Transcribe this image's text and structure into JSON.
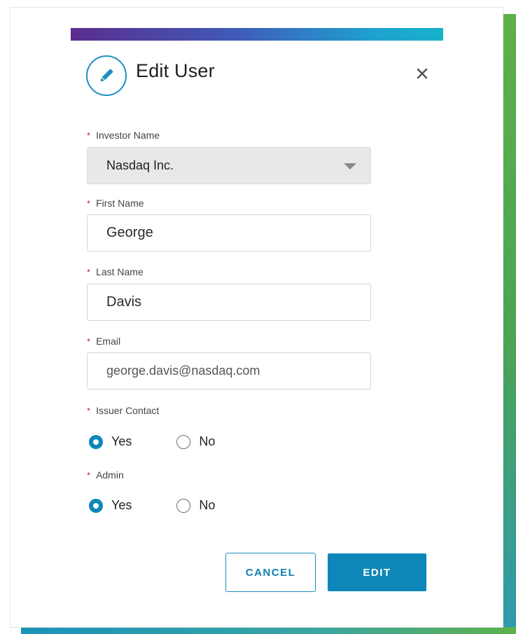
{
  "dialog": {
    "title": "Edit User",
    "header_icon": "pencil-icon",
    "close_icon": "close-icon"
  },
  "fields": {
    "investor_name": {
      "label": "Investor Name",
      "value": "Nasdaq Inc."
    },
    "first_name": {
      "label": "First Name",
      "value": "George"
    },
    "last_name": {
      "label": "Last Name",
      "value": "Davis"
    },
    "email": {
      "label": "Email",
      "value": "george.davis@nasdaq.com"
    },
    "issuer_contact": {
      "label": "Issuer Contact",
      "options": [
        "Yes",
        "No"
      ],
      "selected": "Yes"
    },
    "admin": {
      "label": "Admin",
      "options": [
        "Yes",
        "No"
      ],
      "selected": "Yes"
    }
  },
  "required_marker": "*",
  "buttons": {
    "cancel": "CANCEL",
    "edit": "EDIT"
  },
  "colors": {
    "accent": "#0d87b8",
    "required": "#c2188f",
    "top_bar_start": "#5b2d8e",
    "top_bar_end": "#16b3c9",
    "backdrop": "#5fb04a"
  }
}
